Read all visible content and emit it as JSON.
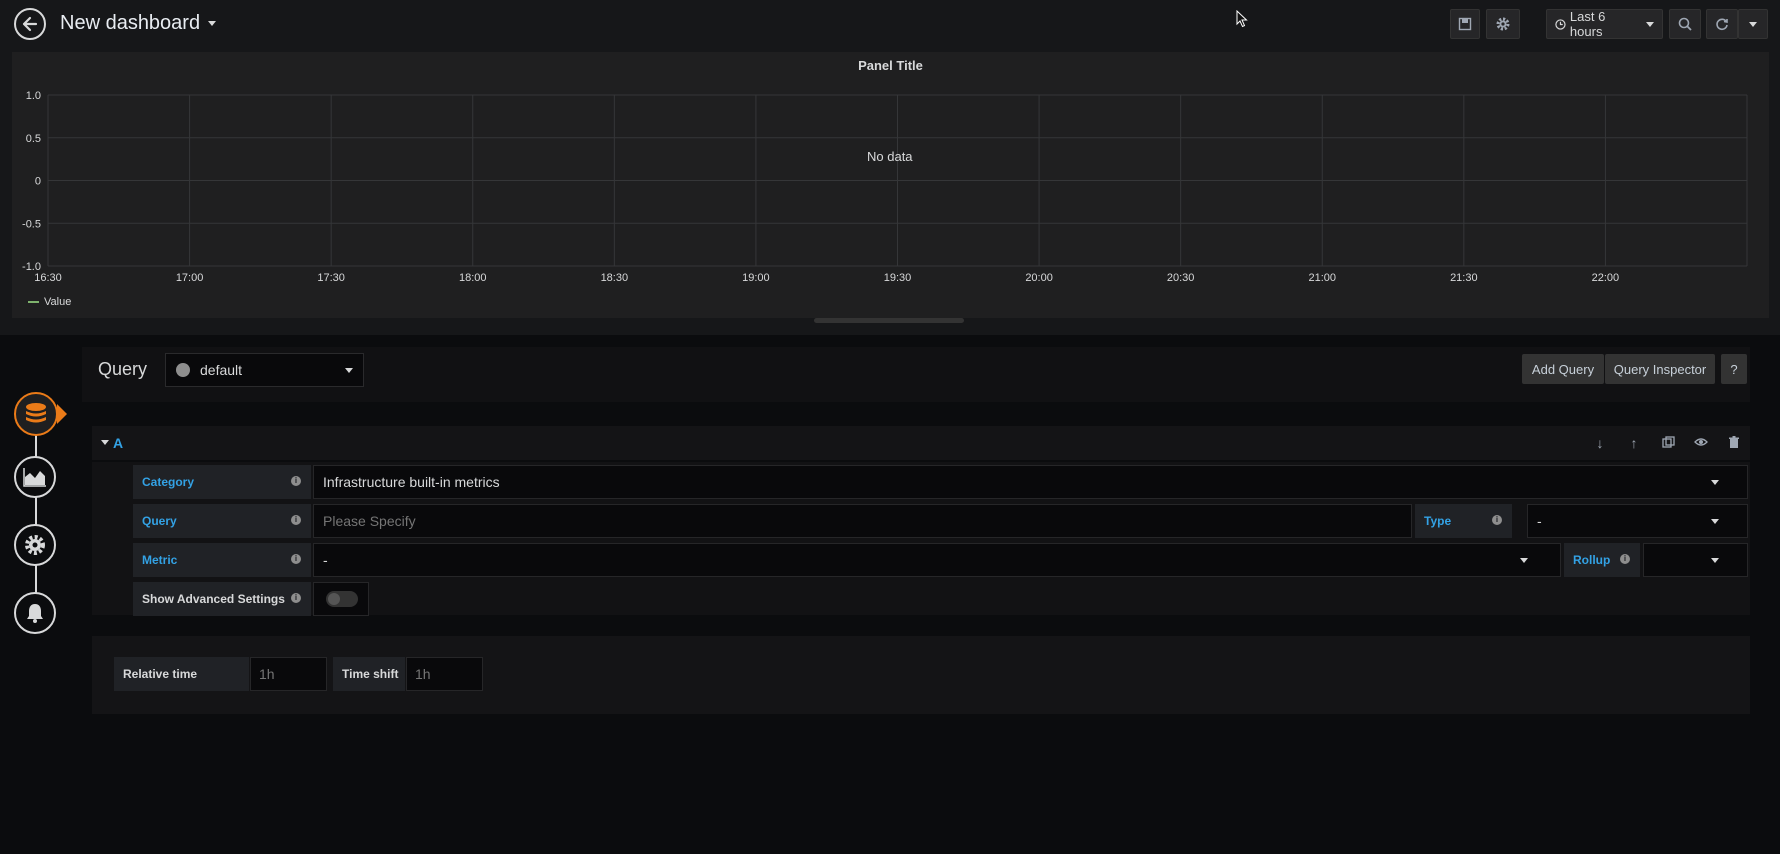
{
  "header": {
    "title": "New dashboard",
    "time_picker_label": "Last 6 hours",
    "icons": [
      "back-arrow-icon",
      "save-icon",
      "gear-icon",
      "clock-icon",
      "zoom-out-icon",
      "refresh-icon",
      "chevron-down-icon"
    ]
  },
  "panel": {
    "title": "Panel Title",
    "no_data": "No data",
    "legend": "Value",
    "legend_color": "#7eb26d"
  },
  "chart_data": {
    "type": "line",
    "title": "Panel Title",
    "x_ticks": [
      "16:30",
      "17:00",
      "17:30",
      "18:00",
      "18:30",
      "19:00",
      "19:30",
      "20:00",
      "20:30",
      "21:00",
      "21:30",
      "22:00"
    ],
    "y_ticks": [
      "1.0",
      "0.5",
      "0",
      "-0.5",
      "-1.0"
    ],
    "ylim": [
      -1.0,
      1.0
    ],
    "series": [
      {
        "name": "Value",
        "values": []
      }
    ],
    "grid": true,
    "legend_position": "bottom-left"
  },
  "editor": {
    "query_label": "Query",
    "datasource": "default",
    "add_query": "Add Query",
    "query_inspector": "Query Inspector",
    "help": "?",
    "row_letter": "A",
    "row_icons": [
      "arrow-down-icon",
      "arrow-up-icon",
      "copy-icon",
      "eye-icon",
      "trash-icon"
    ],
    "fields": {
      "category_label": "Category",
      "category_value": "Infrastructure built-in metrics",
      "query_label": "Query",
      "query_placeholder": "Please Specify",
      "type_label": "Type",
      "type_value": "-",
      "metric_label": "Metric",
      "metric_value": "-",
      "rollup_label": "Rollup",
      "rollup_value": "",
      "advanced_label": "Show Advanced Settings",
      "advanced_enabled": false
    },
    "options": {
      "relative_time_label": "Relative time",
      "relative_time_placeholder": "1h",
      "time_shift_label": "Time shift",
      "time_shift_placeholder": "1h"
    }
  },
  "sidebar": {
    "items": [
      {
        "name": "queries",
        "icon": "database-icon",
        "active": true
      },
      {
        "name": "visualization",
        "icon": "chart-icon",
        "active": false
      },
      {
        "name": "general",
        "icon": "gear-icon",
        "active": false
      },
      {
        "name": "alert",
        "icon": "bell-icon",
        "active": false
      }
    ],
    "accent_color": "#eb7b18"
  }
}
